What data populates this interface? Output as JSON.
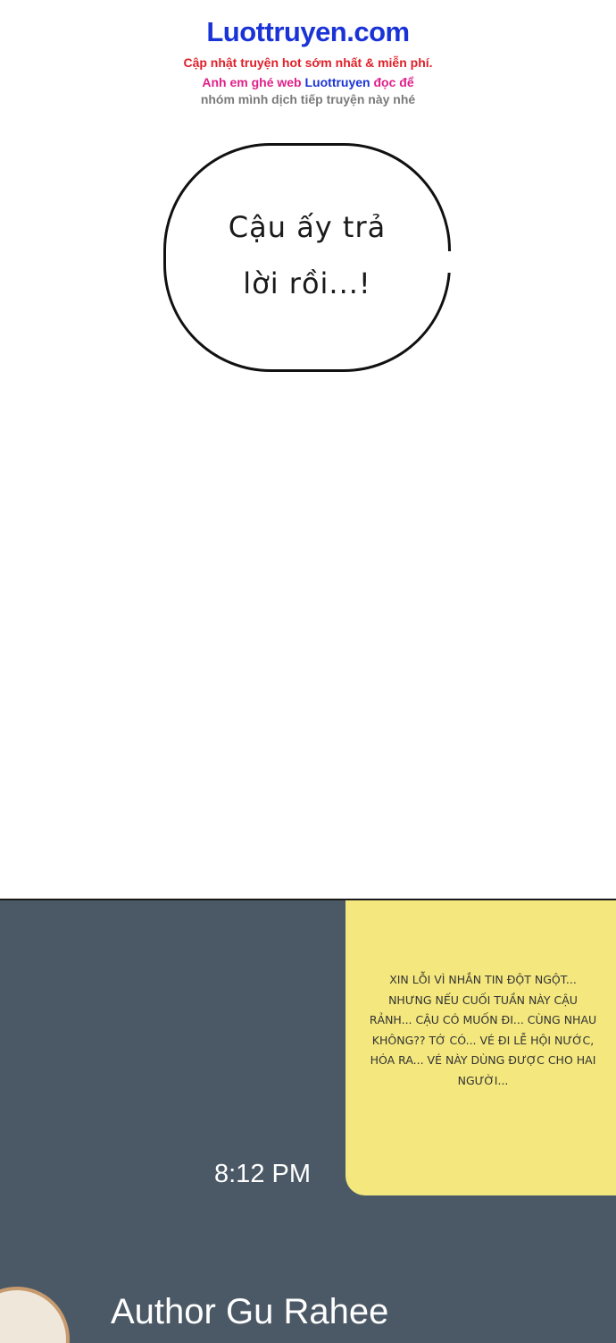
{
  "watermark": {
    "title": "Luottruyen.com",
    "line1": "Cập nhật truyện hot sớm nhất & miễn phí.",
    "line2_prefix": "Anh em ghé web ",
    "line2_brand": "Luottruyen",
    "line2_suffix": " đọc để",
    "line3": "nhóm mình dịch tiếp truyện này nhé"
  },
  "bubble": {
    "line1": "Cậu ấy trả",
    "line2": "lời rồi...!"
  },
  "chat": {
    "message": "Xin lỗi vì nhắn tin đột ngột... nhưng nếu cuối tuần này cậu rảnh... cậu có muốn đi... cùng nhau không?? Tớ có... vé đi lễ hội nước, hóa ra... vé này dùng được cho hai người...",
    "time": "8:12 PM",
    "author": "Author Gu Rahee"
  },
  "colors": {
    "brand_blue": "#1a33d6",
    "panel_bg": "#4b5966",
    "note_yellow": "#f3e77e"
  }
}
